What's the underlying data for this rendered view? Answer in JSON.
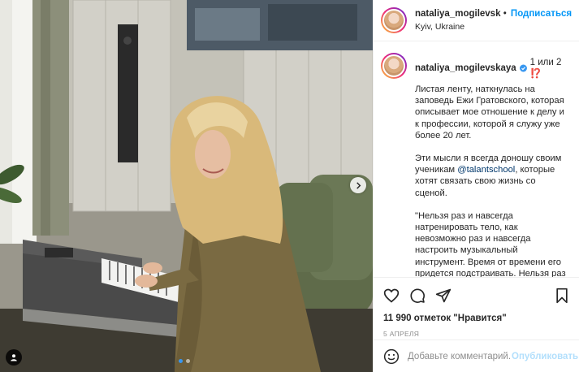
{
  "post": {
    "username": "nataliya_mogilevsk",
    "follow_label": "Подписаться",
    "separator": "•",
    "location": "Kyiv, Ukraine"
  },
  "caption": {
    "username": "nataliya_mogilevskaya",
    "first_line": "1 или 2 ⁉️",
    "paragraph1": "Листая ленту, наткнулась на заповедь Ежи Гратовского, которая описывает мое отношение к делу и к профессии, которой я служу уже более 20 лет.",
    "paragraph2_before": "Эти мысли я всегда доношу своим ученикам ",
    "mention": "@talantschool",
    "paragraph2_after": ", которые хотят связать свою жизнь со сценой.",
    "paragraph3": "\"Нельзя раз и навсегда натренировать тело, как невозможно раз и навсегда настроить музыкальный инструмент. Время от времени его придется подстраивать. Нельзя раз и навсегда наточить нож. Это само собой разумеющиеся вещи. Что в этом"
  },
  "engagement": {
    "likes_text": "11 990 отметок \"Нравится\"",
    "date": "5 АПРЕЛЯ"
  },
  "comment": {
    "placeholder": "Добавьте комментарий...",
    "publish_label": "Опубликовать"
  },
  "media": {
    "slide_index": 1,
    "slide_count": 2
  },
  "icons": {
    "like": "heart-icon",
    "comment": "comment-icon",
    "share": "share-icon",
    "save": "bookmark-icon",
    "emoji": "emoji-icon",
    "next": "chevron-right-icon",
    "tag": "user-tag-icon",
    "verified": "verified-badge-icon"
  },
  "colors": {
    "link_blue": "#0095f6",
    "verified_blue": "#3897f0",
    "publish_disabled": "#b2dffc",
    "muted_text": "#8e8e8e"
  }
}
